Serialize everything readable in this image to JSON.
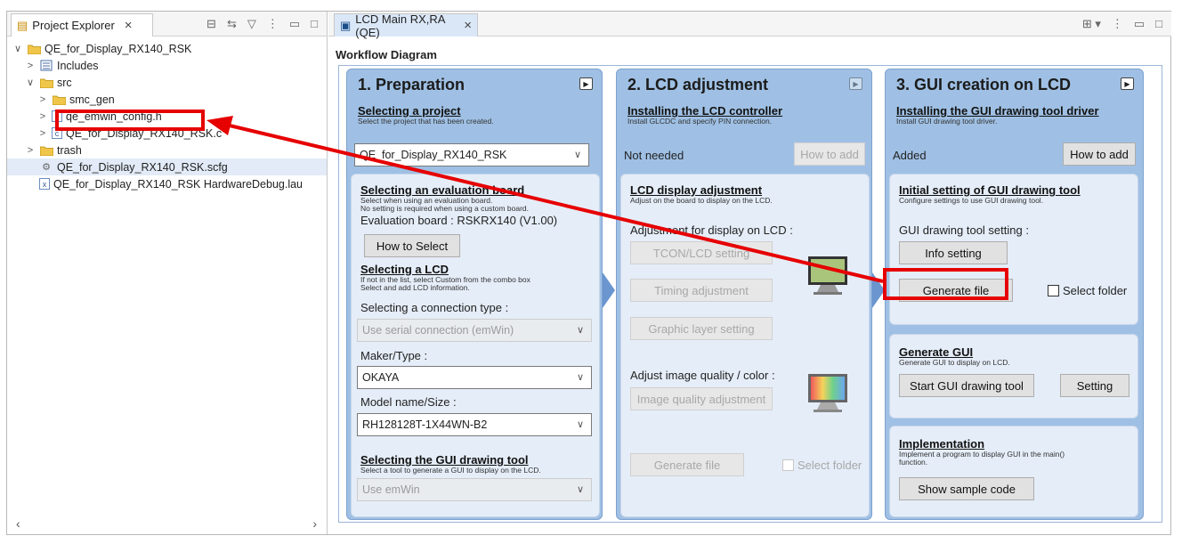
{
  "left_panel": {
    "tab_label": "Project Explorer",
    "tree": [
      {
        "label": "QE_for_Display_RX140_RSK",
        "arrow": "∨",
        "icon": "project-icon",
        "indent": 0
      },
      {
        "label": "Includes",
        "arrow": ">",
        "icon": "includes-icon",
        "indent": 1
      },
      {
        "label": "src",
        "arrow": "∨",
        "icon": "folder-icon",
        "indent": 1
      },
      {
        "label": "smc_gen",
        "arrow": ">",
        "icon": "folder-icon",
        "indent": 2
      },
      {
        "label": "qe_emwin_config.h",
        "arrow": ">",
        "icon": "h-file-icon",
        "indent": 2
      },
      {
        "label": "QE_for_Display_RX140_RSK.c",
        "arrow": ">",
        "icon": "c-file-icon",
        "indent": 2
      },
      {
        "label": "trash",
        "arrow": ">",
        "icon": "folder-icon",
        "indent": 1
      },
      {
        "label": "QE_for_Display_RX140_RSK.scfg",
        "arrow": "",
        "icon": "gear-file-icon",
        "indent": 1,
        "selected": true
      },
      {
        "label": "QE_for_Display_RX140_RSK HardwareDebug.lau",
        "arrow": "",
        "icon": "launch-file-icon",
        "indent": 1
      }
    ]
  },
  "editor": {
    "tab_label": "LCD Main RX,RA (QE)",
    "workflow_title": "Workflow Diagram"
  },
  "col1": {
    "title": "1. Preparation",
    "sel_proj_h": "Selecting a project",
    "sel_proj_s": "Select the project that has been created.",
    "project_combo": "QE_for_Display_RX140_RSK",
    "eval_h": "Selecting an evaluation board",
    "eval_s1": "Select when using an evaluation board.",
    "eval_s2": "No setting is required when using a custom board.",
    "eval_value": "Evaluation board : RSKRX140 (V1.00)",
    "how_to_select": "How to Select",
    "lcd_h": "Selecting a LCD",
    "lcd_s1": "If not in the list, select Custom from the combo box",
    "lcd_s2": "Select and add LCD information.",
    "conn_label": "Selecting a connection type :",
    "conn_combo": "Use serial connection (emWin)",
    "maker_label": "Maker/Type :",
    "maker_combo": "OKAYA",
    "model_label": "Model name/Size :",
    "model_combo": "RH128128T-1X44WN-B2",
    "gui_h": "Selecting the GUI drawing tool",
    "gui_s": "Select a tool to generate a GUI to display on the LCD.",
    "gui_combo": "Use emWin"
  },
  "col2": {
    "title": "2. LCD adjustment",
    "inst_h": "Installing the LCD controller",
    "inst_s": "Install GLCDC and specify PIN connection.",
    "not_needed": "Not needed",
    "how_to_add": "How to add",
    "disp_h": "LCD display adjustment",
    "disp_s": "Adjust on the board to display on the LCD.",
    "adj_label": "Adjustment for display on LCD :",
    "tcon": "TCON/LCD setting",
    "timing": "Timing adjustment",
    "graphic": "Graphic layer setting",
    "quality_label": "Adjust image quality / color :",
    "quality_btn": "Image quality adjustment",
    "gen_file": "Generate file",
    "sel_folder": "Select folder"
  },
  "col3": {
    "title": "3. GUI creation on LCD",
    "inst_h": "Installing the GUI drawing tool driver",
    "inst_s": "Install GUI drawing tool driver.",
    "added": "Added",
    "how_to_add": "How to add",
    "init_h": "Initial setting of GUI drawing tool",
    "init_s": "Configure settings to use GUI drawing tool.",
    "setting_label": "GUI drawing tool setting :",
    "info_setting": "Info setting",
    "gen_file": "Generate file",
    "sel_folder": "Select folder",
    "gen_gui_h": "Generate GUI",
    "gen_gui_s": "Generate GUI to display on LCD.",
    "start_tool": "Start GUI drawing tool",
    "setting": "Setting",
    "impl_h": "Implementation",
    "impl_s1": "Implement a program to display GUI in the main()",
    "impl_s2": "function.",
    "sample": "Show sample code"
  },
  "colors": {
    "annotation": "#e60000",
    "panel": "#9fc0e4",
    "subpanel": "#e5edf8"
  }
}
